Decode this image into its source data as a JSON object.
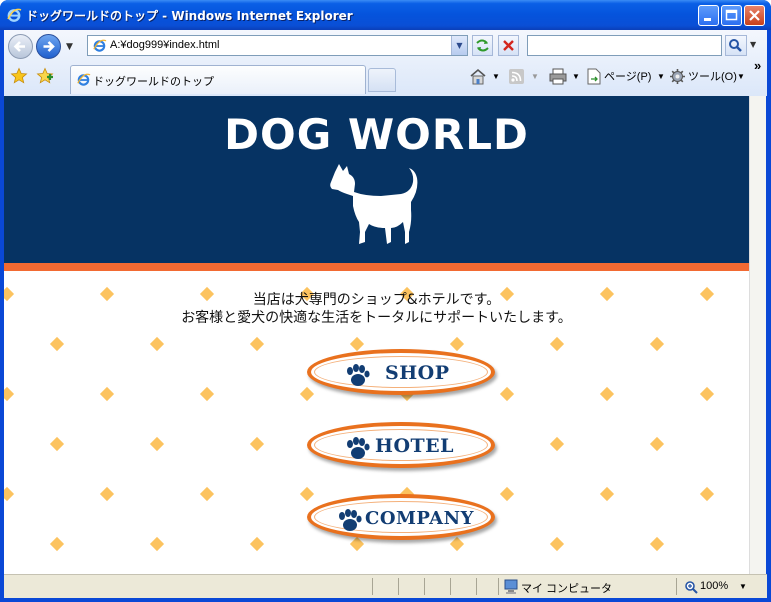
{
  "window": {
    "title": "ドッグワールドのトップ - Windows Internet Explorer"
  },
  "toolbar": {
    "address": "A:¥dog999¥index.html",
    "search_placeholder": "",
    "tab_title": "ドッグワールドのトップ",
    "page_menu": "ページ(P)",
    "tools_menu": "ツール(O)",
    "chevron": "»"
  },
  "page": {
    "site_title": "DOG WORLD",
    "intro_line1": "当店は犬専門のショップ&ホテルです。",
    "intro_line2": "お客様と愛犬の快適な生活をトータルにサポートいたします。",
    "nav": [
      {
        "label": "SHOP"
      },
      {
        "label": "HOTEL"
      },
      {
        "label": "COMPANY"
      }
    ],
    "colors": {
      "banner": "#063363",
      "accent_band": "#f26a32",
      "diamond": "#fcc35f",
      "button_border": "#e9711e",
      "button_text": "#123d73"
    }
  },
  "statusbar": {
    "zone": "マイ コンピュータ",
    "zoom": "100%"
  }
}
